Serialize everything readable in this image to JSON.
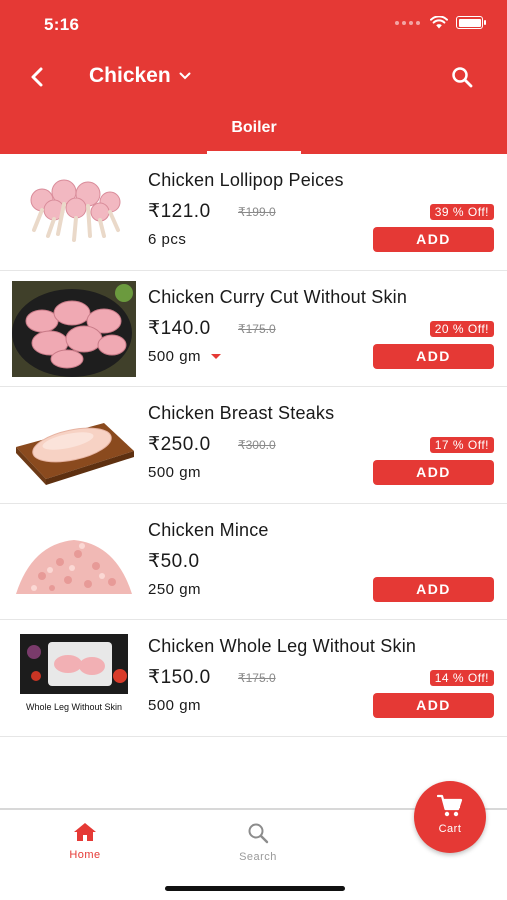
{
  "status_bar": {
    "time": "5:16"
  },
  "header": {
    "title": "Chicken",
    "tab": "Boiler"
  },
  "colors": {
    "accent": "#e53935"
  },
  "products": [
    {
      "name": "Chicken Lollipop Peices",
      "price": "₹121.0",
      "mrp": "₹199.0",
      "discount": "39 % Off!",
      "qty": "6 pcs",
      "add_label": "ADD",
      "has_dropdown": false
    },
    {
      "name": "Chicken Curry Cut Without Skin",
      "price": "₹140.0",
      "mrp": "₹175.0",
      "discount": "20 % Off!",
      "qty": "500 gm",
      "add_label": "ADD",
      "has_dropdown": true
    },
    {
      "name": "Chicken Breast Steaks",
      "price": "₹250.0",
      "mrp": "₹300.0",
      "discount": "17 % Off!",
      "qty": "500 gm",
      "add_label": "ADD",
      "has_dropdown": false
    },
    {
      "name": "Chicken Mince",
      "price": "₹50.0",
      "qty": "250 gm",
      "add_label": "ADD",
      "has_dropdown": false
    },
    {
      "name": "Chicken Whole Leg Without Skin",
      "price": "₹150.0",
      "mrp": "₹175.0",
      "discount": "14 % Off!",
      "qty": "500 gm",
      "add_label": "ADD",
      "has_dropdown": false,
      "image_caption": "Whole Leg Without Skin"
    }
  ],
  "bottom_nav": {
    "home_label": "Home",
    "search_label": "Search",
    "cart_label": "Cart"
  }
}
